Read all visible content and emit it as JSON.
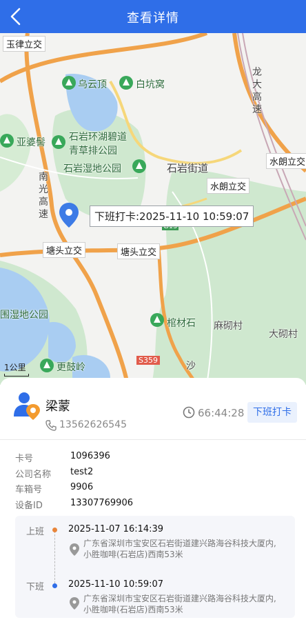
{
  "header": {
    "title": "查看详情"
  },
  "map": {
    "labels": {
      "yuyunding": "乌云顶",
      "baikengwo": "白坑窝",
      "yapojiao": "亚婆髻",
      "shiyan_lake": "石岩环湖碧道",
      "qingcao": "青草排公园",
      "wetland": "石岩湿地公园",
      "shiyan_street": "石岩街道",
      "wetland_left": "围湿地公园",
      "gangcaishi": "棺材石",
      "majiashi": "麻砌村",
      "damajia": "大砌村",
      "genggu": "更鼓岭",
      "nanguang": "南光高速",
      "longda": "龙大高速",
      "sha": "沙"
    },
    "road_tags": {
      "yulv": "玉律立交",
      "shuilang_top": "水朗立交",
      "shuilang": "水朗立交",
      "tangtou_left": "塘头立交",
      "tangtou_right": "塘头立交",
      "g15": "G15",
      "s359": "S359"
    },
    "scale": "1公里",
    "tooltip": "下班打卡:2025-11-10 10:59:07"
  },
  "card": {
    "name": "梁蒙",
    "phone": "13562626545",
    "timer": "66:44:28",
    "status": "下班打卡"
  },
  "details": [
    {
      "label": "卡号",
      "value": "1096396"
    },
    {
      "label": "公司名称",
      "value": "test2"
    },
    {
      "label": "车箱号",
      "value": "9906"
    },
    {
      "label": "设备ID",
      "value": "13307769906"
    }
  ],
  "timeline": {
    "on_duty": {
      "label": "上班",
      "time": "2025-11-07 16:14:39",
      "address": "广东省深圳市宝安区石岩街道建兴路海谷科技大厦内,小胜咖啡(石岩店)西南53米"
    },
    "off_duty": {
      "label": "下班",
      "time": "2025-11-10 10:59:07",
      "address": "广东省深圳市宝安区石岩街道建兴路海谷科技大厦内,小胜咖啡(石岩店)西南53米"
    }
  },
  "colors": {
    "primary": "#2f6ee8",
    "on_dot": "#e8853a",
    "off_dot": "#2f6ee8"
  }
}
